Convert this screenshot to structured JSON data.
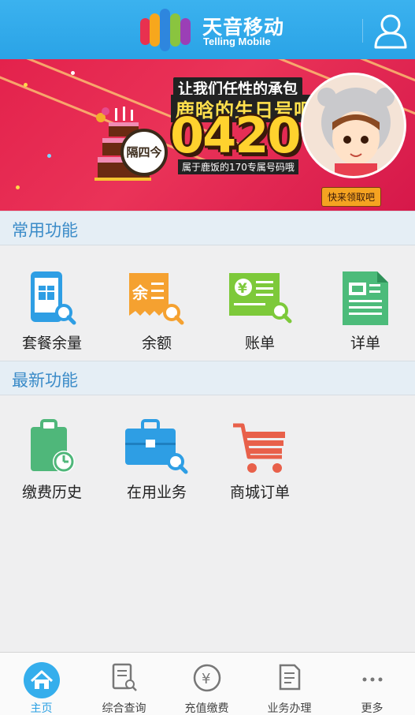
{
  "header": {
    "brand_cn": "天音移动",
    "brand_en": "Telling Mobile"
  },
  "banner": {
    "badge_text": "隔四今",
    "line1": "让我们任性的承包",
    "line2": "鹿晗的生日号吧",
    "number": "0420",
    "sub": "属于鹿饭的170专属号码哦",
    "button_label": "快来领取吧"
  },
  "sections": {
    "common": {
      "title": "常用功能",
      "items": [
        {
          "label": "套餐余量",
          "icon": "phone-gift-search-icon",
          "color": "#2e9ee4"
        },
        {
          "label": "余额",
          "icon": "balance-search-icon",
          "color": "#f5a130"
        },
        {
          "label": "账单",
          "icon": "bill-search-icon",
          "color": "#7dc93a"
        },
        {
          "label": "详单",
          "icon": "detail-list-icon",
          "color": "#4cbb7a"
        }
      ]
    },
    "latest": {
      "title": "最新功能",
      "items": [
        {
          "label": "缴费历史",
          "icon": "payment-history-icon",
          "color": "#4fb77a"
        },
        {
          "label": "在用业务",
          "icon": "briefcase-search-icon",
          "color": "#2e9ee4"
        },
        {
          "label": "商城订单",
          "icon": "shopping-cart-icon",
          "color": "#e8604a"
        }
      ]
    }
  },
  "bottom_nav": [
    {
      "label": "主页",
      "icon": "home-icon",
      "active": true
    },
    {
      "label": "综合查询",
      "icon": "query-icon",
      "active": false
    },
    {
      "label": "充值缴费",
      "icon": "yuan-icon",
      "active": false
    },
    {
      "label": "业务办理",
      "icon": "business-icon",
      "active": false
    },
    {
      "label": "更多",
      "icon": "more-icon",
      "active": false
    }
  ],
  "colors": {
    "header": "#35aeec",
    "section_title": "#3a8bc8",
    "nav_active": "#2aa0e4"
  }
}
